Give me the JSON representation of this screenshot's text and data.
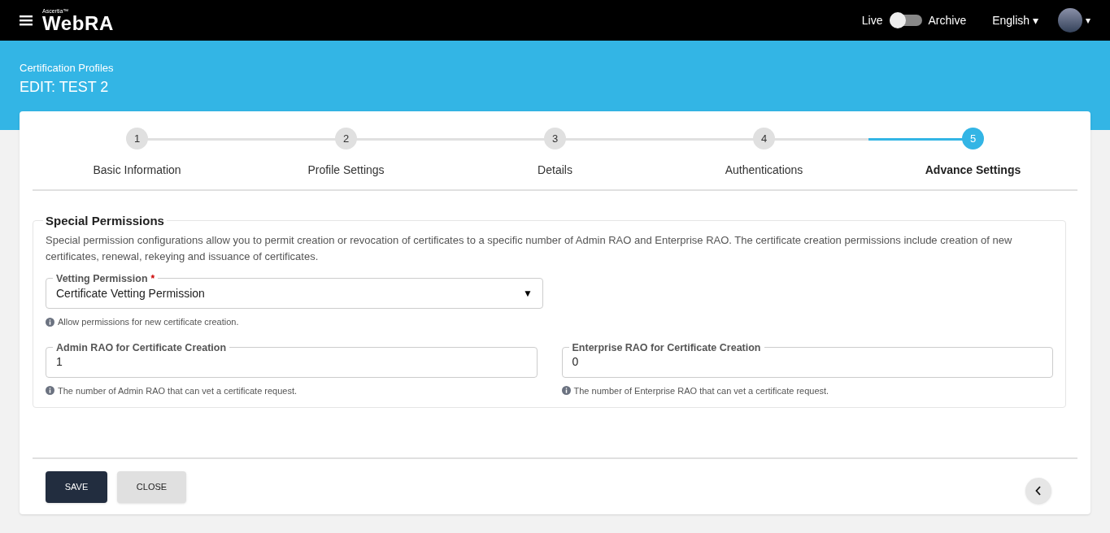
{
  "header": {
    "brand_small": "Ascertia™",
    "brand": "WebRA",
    "toggle": {
      "left_label": "Live",
      "right_label": "Archive",
      "on": false
    },
    "language": "English ▾",
    "user_caret": "▾"
  },
  "page": {
    "breadcrumb": "Certification Profiles",
    "title": "EDIT: TEST 2"
  },
  "steps": [
    {
      "number": "1",
      "label": "Basic Information",
      "selected": false
    },
    {
      "number": "2",
      "label": "Profile Settings",
      "selected": false
    },
    {
      "number": "3",
      "label": "Details",
      "selected": false
    },
    {
      "number": "4",
      "label": "Authentications",
      "selected": false
    },
    {
      "number": "5",
      "label": "Advance Settings",
      "selected": true
    }
  ],
  "section": {
    "title": "Special Permissions",
    "description": "Special permission configurations allow you to permit creation or revocation of certificates to a specific number of Admin RAO and Enterprise RAO. The certificate creation permissions include creation of new certificates, renewal, rekeying and issuance of certificates.",
    "vetting": {
      "label": "Vetting Permission",
      "required_mark": "*",
      "value": "Certificate Vetting Permission",
      "caret": "▼",
      "hint": "Allow permissions for new certificate creation."
    },
    "fields": [
      {
        "label": "Admin RAO for Certificate Creation",
        "value": "1",
        "hint": "The number of Admin RAO that can vet a certificate request."
      },
      {
        "label": "Enterprise RAO for Certificate Creation",
        "value": "0",
        "hint": "The number of Enterprise RAO that can vet a certificate request."
      }
    ]
  },
  "buttons": [
    {
      "label": "SAVE",
      "kind": "primary"
    },
    {
      "label": "CLOSE",
      "kind": "secondary"
    }
  ]
}
